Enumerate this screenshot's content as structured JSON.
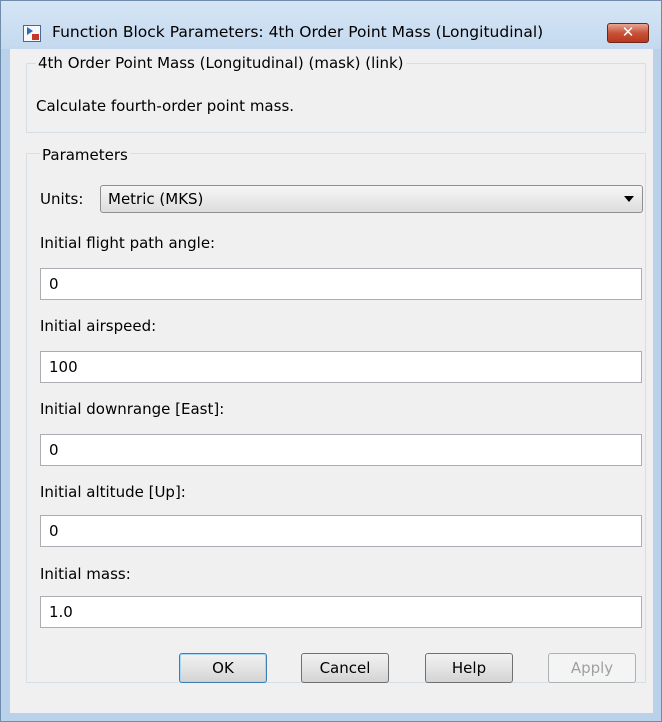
{
  "window": {
    "title": "Function Block Parameters: 4th Order Point Mass (Longitudinal)",
    "close_label": "✕"
  },
  "description": {
    "heading": "4th Order Point Mass (Longitudinal) (mask) (link)",
    "text": "Calculate fourth-order point mass."
  },
  "parameters": {
    "heading": "Parameters",
    "units": {
      "label": "Units:",
      "value": "Metric (MKS)"
    },
    "fields": [
      {
        "label": "Initial flight path angle:",
        "value": "0"
      },
      {
        "label": "Initial airspeed:",
        "value": "100"
      },
      {
        "label": "Initial downrange [East]:",
        "value": "0"
      },
      {
        "label": "Initial altitude [Up]:",
        "value": "0"
      },
      {
        "label": "Initial mass:",
        "value": "1.0"
      }
    ]
  },
  "buttons": {
    "ok": "OK",
    "cancel": "Cancel",
    "help": "Help",
    "apply": "Apply"
  },
  "colors": {
    "window_frame": "#b9d1ea",
    "close_button": "#c75238",
    "client_bg": "#f0f0f0"
  }
}
